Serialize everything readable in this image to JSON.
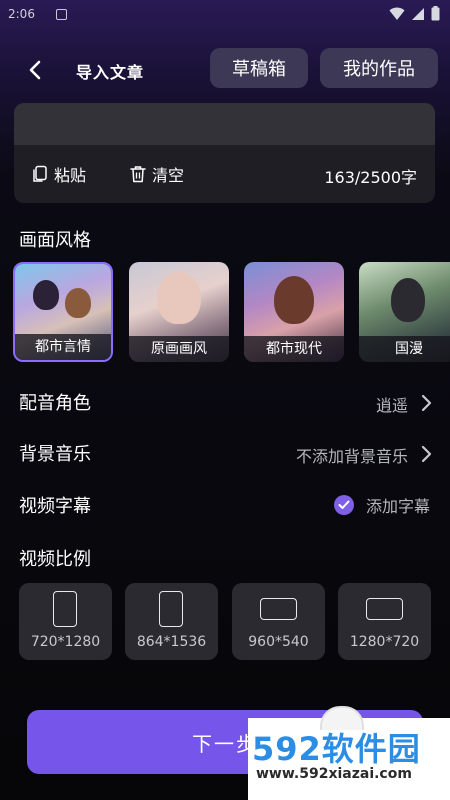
{
  "status_bar": {
    "time": "2:06"
  },
  "header": {
    "title": "导入文章",
    "drafts_label": "草稿箱",
    "works_label": "我的作品"
  },
  "editor": {
    "paste_label": "粘贴",
    "clear_label": "清空",
    "char_count": "163/2500字"
  },
  "style_section": {
    "title": "画面风格",
    "styles": [
      {
        "label": "都市言情",
        "selected": true
      },
      {
        "label": "原画画风",
        "selected": false
      },
      {
        "label": "都市现代",
        "selected": false
      },
      {
        "label": "国漫",
        "selected": false
      }
    ]
  },
  "dubbing": {
    "label": "配音角色",
    "value": "逍遥"
  },
  "music": {
    "label": "背景音乐",
    "value": "不添加背景音乐"
  },
  "subtitle": {
    "label": "视频字幕",
    "value": "添加字幕",
    "checked": true
  },
  "ratio_section": {
    "title": "视频比例",
    "ratios": [
      {
        "label": "720*1280"
      },
      {
        "label": "864*1536"
      },
      {
        "label": "960*540"
      },
      {
        "label": "1280*720"
      }
    ]
  },
  "next_button": {
    "label": "下一步"
  },
  "watermark": {
    "brand": "592软件园",
    "url": "www.592xiazai.com"
  },
  "colors": {
    "accent": "#7656ea",
    "selected_border": "#8c6cff",
    "pill_bg": "#3c3856"
  }
}
